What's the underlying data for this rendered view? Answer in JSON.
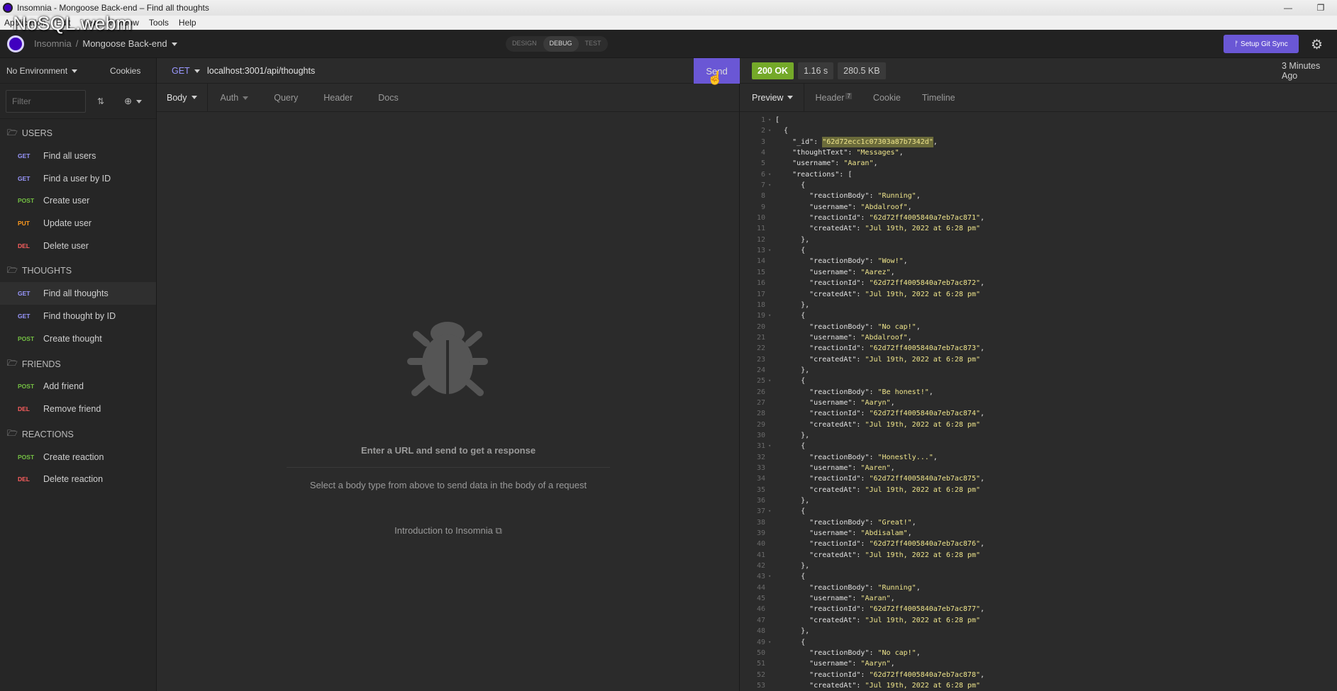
{
  "overlay_label": "NoSQL.webm",
  "window": {
    "title": "Insomnia - Mongoose Back-end – Find all thoughts",
    "controls": [
      "—",
      "❐"
    ]
  },
  "menubar": [
    "Application",
    "Edit",
    "View",
    "Window",
    "Tools",
    "Help"
  ],
  "topbar": {
    "workspace": "Insomnia",
    "separator": "/",
    "project": "Mongoose Back-end",
    "modes": [
      "DESIGN",
      "DEBUG",
      "TEST"
    ],
    "active_mode": "DEBUG",
    "git_button": "ᚠ Setup Git Sync"
  },
  "sidebar": {
    "environment": "No Environment",
    "cookies": "Cookies",
    "filter_placeholder": "Filter",
    "groups": [
      {
        "name": "USERS",
        "items": [
          {
            "method": "GET",
            "label": "Find all users"
          },
          {
            "method": "GET",
            "label": "Find a user by ID"
          },
          {
            "method": "POST",
            "label": "Create user"
          },
          {
            "method": "PUT",
            "label": "Update user"
          },
          {
            "method": "DEL",
            "label": "Delete user"
          }
        ]
      },
      {
        "name": "THOUGHTS",
        "items": [
          {
            "method": "GET",
            "label": "Find all thoughts",
            "active": true
          },
          {
            "method": "GET",
            "label": "Find thought by ID"
          },
          {
            "method": "POST",
            "label": "Create thought"
          }
        ]
      },
      {
        "name": "FRIENDS",
        "items": [
          {
            "method": "POST",
            "label": "Add friend"
          },
          {
            "method": "DEL",
            "label": "Remove friend"
          }
        ]
      },
      {
        "name": "REACTIONS",
        "items": [
          {
            "method": "POST",
            "label": "Create reaction"
          },
          {
            "method": "DEL",
            "label": "Delete reaction"
          }
        ]
      }
    ]
  },
  "request": {
    "method": "GET",
    "url": "localhost:3001/api/thoughts",
    "send": "Send",
    "tabs": [
      "Body",
      "Auth",
      "Query",
      "Header",
      "Docs"
    ],
    "empty_title": "Enter a URL and send to get a response",
    "empty_sub": "Select a body type from above to send data in the body of a request",
    "intro_link": "Introduction to Insomnia"
  },
  "response": {
    "status": "200 OK",
    "time": "1.16 s",
    "size": "280.5 KB",
    "ago": "3 Minutes Ago",
    "tabs": [
      "Preview",
      "Header",
      "Cookie",
      "Timeline"
    ],
    "header_count": "7",
    "lines": [
      {
        "n": "1",
        "f": "▾",
        "t": "["
      },
      {
        "n": "2",
        "f": "▾",
        "t": "  {"
      },
      {
        "n": "3",
        "f": "",
        "k": "    \"_id\": ",
        "s": "\"62d72ecc1c07303a87b7342d\"",
        "e": ",",
        "hl": true
      },
      {
        "n": "4",
        "f": "",
        "k": "    \"thoughtText\": ",
        "s": "\"Messages\"",
        "e": ","
      },
      {
        "n": "5",
        "f": "",
        "k": "    \"username\": ",
        "s": "\"Aaran\"",
        "e": ","
      },
      {
        "n": "6",
        "f": "▾",
        "k": "    \"reactions\": [",
        "s": "",
        "e": ""
      },
      {
        "n": "7",
        "f": "▾",
        "t": "      {"
      },
      {
        "n": "8",
        "f": "",
        "k": "        \"reactionBody\": ",
        "s": "\"Running\"",
        "e": ","
      },
      {
        "n": "9",
        "f": "",
        "k": "        \"username\": ",
        "s": "\"Abdalroof\"",
        "e": ","
      },
      {
        "n": "10",
        "f": "",
        "k": "        \"reactionId\": ",
        "s": "\"62d72ff4005840a7eb7ac871\"",
        "e": ","
      },
      {
        "n": "11",
        "f": "",
        "k": "        \"createdAt\": ",
        "s": "\"Jul 19th, 2022 at 6:28 pm\"",
        "e": ""
      },
      {
        "n": "12",
        "f": "",
        "t": "      },"
      },
      {
        "n": "13",
        "f": "▾",
        "t": "      {"
      },
      {
        "n": "14",
        "f": "",
        "k": "        \"reactionBody\": ",
        "s": "\"Wow!\"",
        "e": ","
      },
      {
        "n": "15",
        "f": "",
        "k": "        \"username\": ",
        "s": "\"Aarez\"",
        "e": ","
      },
      {
        "n": "16",
        "f": "",
        "k": "        \"reactionId\": ",
        "s": "\"62d72ff4005840a7eb7ac872\"",
        "e": ","
      },
      {
        "n": "17",
        "f": "",
        "k": "        \"createdAt\": ",
        "s": "\"Jul 19th, 2022 at 6:28 pm\"",
        "e": ""
      },
      {
        "n": "18",
        "f": "",
        "t": "      },"
      },
      {
        "n": "19",
        "f": "▾",
        "t": "      {"
      },
      {
        "n": "20",
        "f": "",
        "k": "        \"reactionBody\": ",
        "s": "\"No cap!\"",
        "e": ","
      },
      {
        "n": "21",
        "f": "",
        "k": "        \"username\": ",
        "s": "\"Abdalroof\"",
        "e": ","
      },
      {
        "n": "22",
        "f": "",
        "k": "        \"reactionId\": ",
        "s": "\"62d72ff4005840a7eb7ac873\"",
        "e": ","
      },
      {
        "n": "23",
        "f": "",
        "k": "        \"createdAt\": ",
        "s": "\"Jul 19th, 2022 at 6:28 pm\"",
        "e": ""
      },
      {
        "n": "24",
        "f": "",
        "t": "      },"
      },
      {
        "n": "25",
        "f": "▾",
        "t": "      {"
      },
      {
        "n": "26",
        "f": "",
        "k": "        \"reactionBody\": ",
        "s": "\"Be honest!\"",
        "e": ","
      },
      {
        "n": "27",
        "f": "",
        "k": "        \"username\": ",
        "s": "\"Aaryn\"",
        "e": ","
      },
      {
        "n": "28",
        "f": "",
        "k": "        \"reactionId\": ",
        "s": "\"62d72ff4005840a7eb7ac874\"",
        "e": ","
      },
      {
        "n": "29",
        "f": "",
        "k": "        \"createdAt\": ",
        "s": "\"Jul 19th, 2022 at 6:28 pm\"",
        "e": ""
      },
      {
        "n": "30",
        "f": "",
        "t": "      },"
      },
      {
        "n": "31",
        "f": "▾",
        "t": "      {"
      },
      {
        "n": "32",
        "f": "",
        "k": "        \"reactionBody\": ",
        "s": "\"Honestly...\"",
        "e": ","
      },
      {
        "n": "33",
        "f": "",
        "k": "        \"username\": ",
        "s": "\"Aaren\"",
        "e": ","
      },
      {
        "n": "34",
        "f": "",
        "k": "        \"reactionId\": ",
        "s": "\"62d72ff4005840a7eb7ac875\"",
        "e": ","
      },
      {
        "n": "35",
        "f": "",
        "k": "        \"createdAt\": ",
        "s": "\"Jul 19th, 2022 at 6:28 pm\"",
        "e": ""
      },
      {
        "n": "36",
        "f": "",
        "t": "      },"
      },
      {
        "n": "37",
        "f": "▾",
        "t": "      {"
      },
      {
        "n": "38",
        "f": "",
        "k": "        \"reactionBody\": ",
        "s": "\"Great!\"",
        "e": ","
      },
      {
        "n": "39",
        "f": "",
        "k": "        \"username\": ",
        "s": "\"Abdisalam\"",
        "e": ","
      },
      {
        "n": "40",
        "f": "",
        "k": "        \"reactionId\": ",
        "s": "\"62d72ff4005840a7eb7ac876\"",
        "e": ","
      },
      {
        "n": "41",
        "f": "",
        "k": "        \"createdAt\": ",
        "s": "\"Jul 19th, 2022 at 6:28 pm\"",
        "e": ""
      },
      {
        "n": "42",
        "f": "",
        "t": "      },"
      },
      {
        "n": "43",
        "f": "▾",
        "t": "      {"
      },
      {
        "n": "44",
        "f": "",
        "k": "        \"reactionBody\": ",
        "s": "\"Running\"",
        "e": ","
      },
      {
        "n": "45",
        "f": "",
        "k": "        \"username\": ",
        "s": "\"Aaran\"",
        "e": ","
      },
      {
        "n": "46",
        "f": "",
        "k": "        \"reactionId\": ",
        "s": "\"62d72ff4005840a7eb7ac877\"",
        "e": ","
      },
      {
        "n": "47",
        "f": "",
        "k": "        \"createdAt\": ",
        "s": "\"Jul 19th, 2022 at 6:28 pm\"",
        "e": ""
      },
      {
        "n": "48",
        "f": "",
        "t": "      },"
      },
      {
        "n": "49",
        "f": "▾",
        "t": "      {"
      },
      {
        "n": "50",
        "f": "",
        "k": "        \"reactionBody\": ",
        "s": "\"No cap!\"",
        "e": ","
      },
      {
        "n": "51",
        "f": "",
        "k": "        \"username\": ",
        "s": "\"Aaryn\"",
        "e": ","
      },
      {
        "n": "52",
        "f": "",
        "k": "        \"reactionId\": ",
        "s": "\"62d72ff4005840a7eb7ac878\"",
        "e": ","
      },
      {
        "n": "53",
        "f": "",
        "k": "        \"createdAt\": ",
        "s": "\"Jul 19th, 2022 at 6:28 pm\"",
        "e": ""
      }
    ]
  },
  "colors": {
    "accent": "#6a57d5",
    "ok": "#74a929",
    "get": "#9a98ff",
    "post": "#74c043",
    "put": "#ff9a1f",
    "del": "#ff5f5f"
  }
}
